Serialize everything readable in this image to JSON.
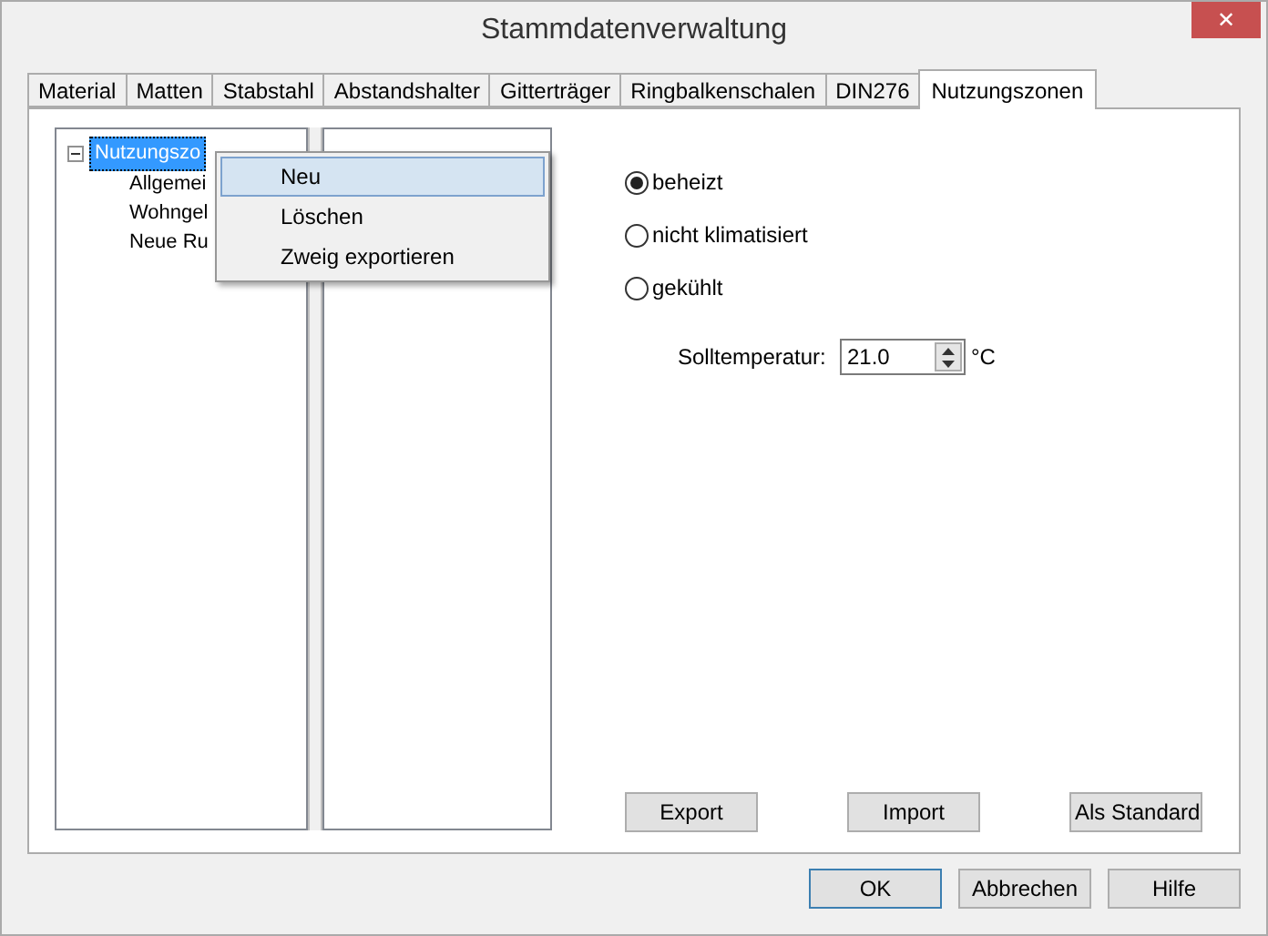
{
  "window": {
    "title": "Stammdatenverwaltung",
    "close": "✕"
  },
  "tabs": [
    {
      "label": "Material",
      "selected": false
    },
    {
      "label": "Matten",
      "selected": false
    },
    {
      "label": "Stabstahl",
      "selected": false
    },
    {
      "label": "Abstandshalter",
      "selected": false
    },
    {
      "label": "Gitterträger",
      "selected": false
    },
    {
      "label": "Ringbalkenschalen",
      "selected": false
    },
    {
      "label": "DIN276",
      "selected": false
    },
    {
      "label": "Nutzungszonen",
      "selected": true
    }
  ],
  "tree": {
    "label": "Nutzungszo",
    "selected": true,
    "expanded": true,
    "children": [
      {
        "label": "Allgemei"
      },
      {
        "label": "Wohngel"
      },
      {
        "label": "Neue Ru"
      }
    ]
  },
  "context_menu": [
    {
      "label": "Neu",
      "selected": true
    },
    {
      "label": "Löschen",
      "selected": false
    },
    {
      "label": "Zweig exportieren",
      "selected": false
    }
  ],
  "radios": [
    {
      "label": "beheizt",
      "selected": true
    },
    {
      "label": "nicht klimatisiert",
      "selected": false
    },
    {
      "label": "gekühlt",
      "selected": false
    }
  ],
  "temperature": {
    "label": "Solltemperatur:",
    "value": "21.0",
    "unit": "°C"
  },
  "panel_buttons": [
    "Export",
    "Import",
    "Als Standard"
  ],
  "dialog_buttons": [
    {
      "label": "OK",
      "default": true
    },
    {
      "label": "Abbrechen",
      "default": false
    },
    {
      "label": "Hilfe",
      "default": false
    }
  ]
}
